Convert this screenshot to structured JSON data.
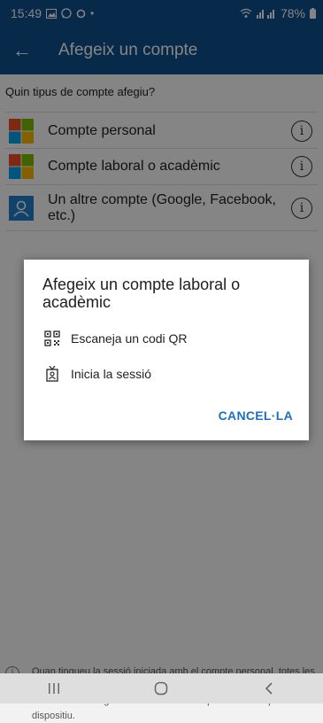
{
  "status": {
    "time": "15:49",
    "battery": "78%"
  },
  "appbar": {
    "title": "Afegeix un compte"
  },
  "prompt": "Quin tipus de compte afegiu?",
  "accounts": [
    {
      "label": "Compte personal"
    },
    {
      "label": "Compte laboral o acadèmic"
    },
    {
      "label": "Un altre compte (Google, Facebook, etc.)"
    }
  ],
  "dialog": {
    "title": "Afegeix un compte laboral o acadèmic",
    "options": [
      {
        "label": "Escaneja un codi QR"
      },
      {
        "label": "Inicia la sessió"
      }
    ],
    "cancel": "CANCEL·LA"
  },
  "footer_note": "Quan tingueu la sessió iniciada amb el compte personal, totes les contrasenyes, les adreces i altres tipus de dades d'emplenament automàtic emmagatzemades estaran disponibles en aquest dispositiu.",
  "colors": {
    "appbar": "#0f4f8f",
    "accent": "#1f6fc0",
    "ms_red": "#f25022",
    "ms_green": "#7fba00",
    "ms_blue": "#00a4ef",
    "ms_yellow": "#ffb900"
  }
}
